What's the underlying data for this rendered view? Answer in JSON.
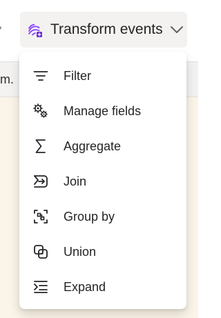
{
  "window": {
    "left_band_text": "m."
  },
  "toolbar": {
    "transform_button": {
      "label": "Transform events",
      "icon_name": "transform-icon",
      "chevron_icon_name": "chevron-down-icon"
    }
  },
  "menu": {
    "items": [
      {
        "label": "Filter",
        "icon_name": "filter-icon"
      },
      {
        "label": "Manage fields",
        "icon_name": "manage-fields-icon"
      },
      {
        "label": "Aggregate",
        "icon_name": "aggregate-icon"
      },
      {
        "label": "Join",
        "icon_name": "join-icon"
      },
      {
        "label": "Group by",
        "icon_name": "group-by-icon"
      },
      {
        "label": "Union",
        "icon_name": "union-icon"
      },
      {
        "label": "Expand",
        "icon_name": "expand-icon"
      }
    ]
  },
  "colors": {
    "accent": "#8a3ffc",
    "icon": "#242424",
    "muted": "#605e5c",
    "menu_background": "#ffffff",
    "page_background": "#fbf4e8"
  }
}
